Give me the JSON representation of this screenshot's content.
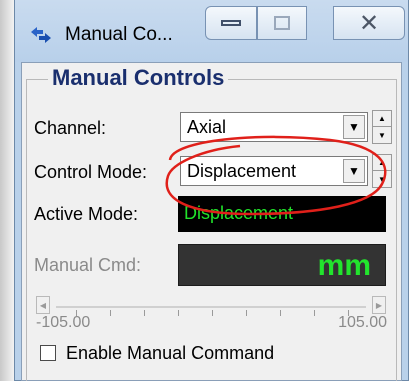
{
  "window": {
    "title": "Manual Co...",
    "title_icon": "arrows-icon",
    "close_glyph": "✕"
  },
  "group": {
    "title": "Manual Controls"
  },
  "channel": {
    "label": "Channel:",
    "value": "Axial"
  },
  "control_mode": {
    "label": "Control Mode:",
    "value": "Displacement"
  },
  "active_mode": {
    "label": "Active Mode:",
    "value": "Displacement"
  },
  "manual_cmd": {
    "label": "Manual Cmd:",
    "unit": "mm"
  },
  "slider": {
    "min": "-105.00",
    "max": "105.00"
  },
  "enable_checkbox": {
    "label": "Enable Manual Command",
    "checked": false
  },
  "colors": {
    "accent_title": "#1a2f6e",
    "readout_green": "#21e32b",
    "annotation_red": "#e0201a"
  }
}
